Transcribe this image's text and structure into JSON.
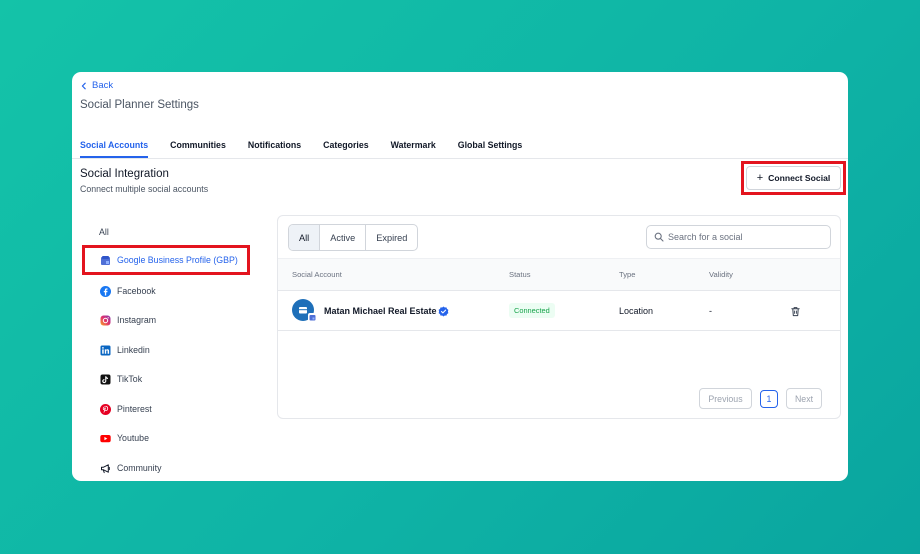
{
  "header": {
    "back_label": "Back",
    "page_title": "Social Planner Settings"
  },
  "tabs": [
    {
      "label": "Social Accounts",
      "active": true
    },
    {
      "label": "Communities",
      "active": false
    },
    {
      "label": "Notifications",
      "active": false
    },
    {
      "label": "Categories",
      "active": false
    },
    {
      "label": "Watermark",
      "active": false
    },
    {
      "label": "Global Settings",
      "active": false
    }
  ],
  "section": {
    "title": "Social Integration",
    "subtitle": "Connect multiple social accounts",
    "connect_label": "Connect Social"
  },
  "sidebar": {
    "items": [
      {
        "label": "All",
        "icon": ""
      },
      {
        "label": "Google Business Profile (GBP)",
        "icon": "gbp-icon",
        "selected": true
      },
      {
        "label": "Facebook",
        "icon": "facebook-icon"
      },
      {
        "label": "Instagram",
        "icon": "instagram-icon"
      },
      {
        "label": "Linkedin",
        "icon": "linkedin-icon"
      },
      {
        "label": "TikTok",
        "icon": "tiktok-icon"
      },
      {
        "label": "Pinterest",
        "icon": "pinterest-icon"
      },
      {
        "label": "Youtube",
        "icon": "youtube-icon"
      },
      {
        "label": "Community",
        "icon": "megaphone-icon"
      }
    ]
  },
  "filters": {
    "all": "All",
    "active": "Active",
    "expired": "Expired",
    "selected": "All"
  },
  "search": {
    "placeholder": "Search for a social",
    "value": ""
  },
  "table": {
    "columns": [
      "Social Account",
      "Status",
      "Type",
      "Validity"
    ],
    "rows": [
      {
        "account": "Matan Michael Real Estate",
        "verified": true,
        "status": "Connected",
        "type": "Location",
        "validity": "-"
      }
    ]
  },
  "pagination": {
    "previous": "Previous",
    "page": "1",
    "next": "Next"
  },
  "colors": {
    "accent": "#2563eb",
    "highlight": "#e3141e",
    "status_connected": "#16a34a",
    "background": "#14c3a8"
  }
}
